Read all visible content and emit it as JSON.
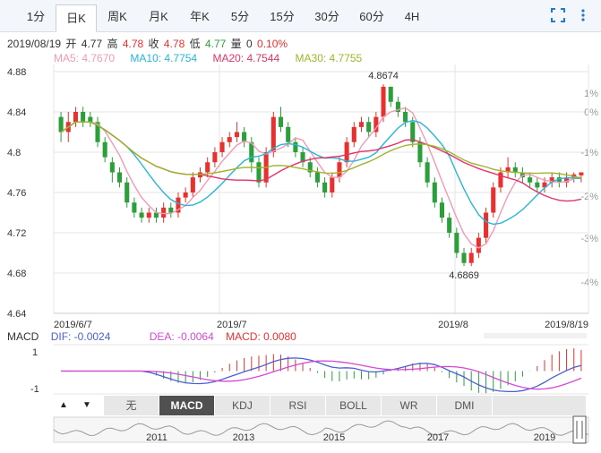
{
  "tabs": [
    {
      "label": "1分",
      "active": false
    },
    {
      "label": "日K",
      "active": true
    },
    {
      "label": "周K",
      "active": false
    },
    {
      "label": "月K",
      "active": false
    },
    {
      "label": "年K",
      "active": false
    },
    {
      "label": "5分",
      "active": false
    },
    {
      "label": "15分",
      "active": false
    },
    {
      "label": "30分",
      "active": false
    },
    {
      "label": "60分",
      "active": false
    },
    {
      "label": "4H",
      "active": false
    }
  ],
  "info": {
    "date": "2019/08/19",
    "open_label": "开",
    "open": "4.77",
    "high_label": "高",
    "high": "4.78",
    "close_label": "收",
    "close": "4.78",
    "low_label": "低",
    "low": "4.77",
    "vol_label": "量",
    "vol": "0",
    "change": "0.10%"
  },
  "ma": {
    "ma5": "MA5: 4.7670",
    "ma10": "MA10: 4.7754",
    "ma20": "MA20: 4.7544",
    "ma30": "MA30: 4.7755"
  },
  "colors": {
    "up": "#e8312f",
    "down": "#2a9f3a",
    "ma5": "#f29ab5",
    "ma10": "#27b6d6",
    "ma20": "#e2336b",
    "ma30": "#9fb52b",
    "dif": "#4a5fd0",
    "dea": "#d548d4",
    "grid": "#e6e6e6"
  },
  "chart_data": {
    "type": "candlestick",
    "y_ticks": [
      "4.88",
      "4.84",
      "4.8",
      "4.76",
      "4.72",
      "4.68",
      "4.64"
    ],
    "pct_ticks": [
      "1%",
      "0%",
      "-1%",
      "-2%",
      "-3%",
      "-4%"
    ],
    "ylim": [
      4.64,
      4.88
    ],
    "x_labels": [
      "2019/6/7",
      "2019/7",
      "2019/8",
      "2019/8/19"
    ],
    "max_label": "4.8674",
    "min_label": "4.6869",
    "candles": [
      [
        4.835,
        4.82,
        4.84,
        4.81
      ],
      [
        4.82,
        4.83,
        4.84,
        4.81
      ],
      [
        4.83,
        4.84,
        4.845,
        4.825
      ],
      [
        4.84,
        4.83,
        4.845,
        4.825
      ],
      [
        4.835,
        4.83,
        4.84,
        4.825
      ],
      [
        4.83,
        4.81,
        4.835,
        4.805
      ],
      [
        4.81,
        4.795,
        4.815,
        4.79
      ],
      [
        4.79,
        4.78,
        4.795,
        4.77
      ],
      [
        4.78,
        4.77,
        4.785,
        4.765
      ],
      [
        4.77,
        4.75,
        4.775,
        4.745
      ],
      [
        4.75,
        4.74,
        4.755,
        4.735
      ],
      [
        4.74,
        4.735,
        4.745,
        4.73
      ],
      [
        4.735,
        4.74,
        4.745,
        4.73
      ],
      [
        4.74,
        4.735,
        4.745,
        4.73
      ],
      [
        4.735,
        4.745,
        4.75,
        4.73
      ],
      [
        4.745,
        4.74,
        4.75,
        4.735
      ],
      [
        4.74,
        4.755,
        4.76,
        4.735
      ],
      [
        4.755,
        4.76,
        4.765,
        4.75
      ],
      [
        4.76,
        4.775,
        4.78,
        4.755
      ],
      [
        4.775,
        4.78,
        4.785,
        4.77
      ],
      [
        4.78,
        4.79,
        4.795,
        4.775
      ],
      [
        4.79,
        4.8,
        4.805,
        4.785
      ],
      [
        4.8,
        4.81,
        4.815,
        4.795
      ],
      [
        4.81,
        4.815,
        4.82,
        4.805
      ],
      [
        4.815,
        4.82,
        4.83,
        4.81
      ],
      [
        4.82,
        4.81,
        4.825,
        4.805
      ],
      [
        4.81,
        4.79,
        4.815,
        4.78
      ],
      [
        4.79,
        4.77,
        4.795,
        4.765
      ],
      [
        4.77,
        4.8,
        4.805,
        4.765
      ],
      [
        4.8,
        4.835,
        4.84,
        4.795
      ],
      [
        4.835,
        4.825,
        4.845,
        4.82
      ],
      [
        4.825,
        4.81,
        4.83,
        4.805
      ],
      [
        4.81,
        4.8,
        4.815,
        4.795
      ],
      [
        4.8,
        4.79,
        4.805,
        4.785
      ],
      [
        4.79,
        4.78,
        4.795,
        4.775
      ],
      [
        4.78,
        4.77,
        4.785,
        4.765
      ],
      [
        4.77,
        4.76,
        4.775,
        4.755
      ],
      [
        4.76,
        4.775,
        4.78,
        4.755
      ],
      [
        4.775,
        4.79,
        4.795,
        4.77
      ],
      [
        4.79,
        4.81,
        4.815,
        4.785
      ],
      [
        4.81,
        4.825,
        4.83,
        4.805
      ],
      [
        4.825,
        4.83,
        4.835,
        4.82
      ],
      [
        4.83,
        4.82,
        4.835,
        4.815
      ],
      [
        4.82,
        4.835,
        4.84,
        4.815
      ],
      [
        4.835,
        4.865,
        4.8674,
        4.83
      ],
      [
        4.865,
        4.85,
        4.865,
        4.845
      ],
      [
        4.85,
        4.84,
        4.855,
        4.835
      ],
      [
        4.84,
        4.83,
        4.845,
        4.825
      ],
      [
        4.83,
        4.81,
        4.835,
        4.805
      ],
      [
        4.81,
        4.79,
        4.815,
        4.785
      ],
      [
        4.79,
        4.77,
        4.795,
        4.765
      ],
      [
        4.77,
        4.75,
        4.775,
        4.745
      ],
      [
        4.75,
        4.735,
        4.755,
        4.73
      ],
      [
        4.735,
        4.72,
        4.74,
        4.715
      ],
      [
        4.72,
        4.7,
        4.725,
        4.695
      ],
      [
        4.7,
        4.69,
        4.705,
        4.6869
      ],
      [
        4.69,
        4.7,
        4.705,
        4.6869
      ],
      [
        4.7,
        4.715,
        4.72,
        4.695
      ],
      [
        4.715,
        4.74,
        4.745,
        4.71
      ],
      [
        4.74,
        4.765,
        4.77,
        4.735
      ],
      [
        4.765,
        4.78,
        4.785,
        4.76
      ],
      [
        4.78,
        4.785,
        4.795,
        4.775
      ],
      [
        4.785,
        4.78,
        4.79,
        4.775
      ],
      [
        4.78,
        4.775,
        4.785,
        4.77
      ],
      [
        4.775,
        4.77,
        4.78,
        4.765
      ],
      [
        4.77,
        4.765,
        4.775,
        4.76
      ],
      [
        4.765,
        4.77,
        4.775,
        4.76
      ],
      [
        4.77,
        4.775,
        4.78,
        4.765
      ],
      [
        4.775,
        4.77,
        4.78,
        4.765
      ],
      [
        4.77,
        4.775,
        4.78,
        4.765
      ],
      [
        4.775,
        4.778,
        4.78,
        4.77
      ],
      [
        4.777,
        4.78,
        4.78,
        4.77
      ]
    ]
  },
  "macd": {
    "label": "MACD",
    "dif": "DIF: -0.0024",
    "dea": "DEA: -0.0064",
    "macd": "MACD: 0.0080",
    "y_ticks": [
      "1",
      "-1"
    ]
  },
  "nav": {
    "prev": "▲",
    "next": "▼"
  },
  "indicator_tabs": [
    {
      "label": "无",
      "active": false
    },
    {
      "label": "MACD",
      "active": true
    },
    {
      "label": "KDJ",
      "active": false
    },
    {
      "label": "RSI",
      "active": false
    },
    {
      "label": "BOLL",
      "active": false
    },
    {
      "label": "WR",
      "active": false
    },
    {
      "label": "DMI",
      "active": false
    }
  ],
  "overview": {
    "year_labels": [
      "2011",
      "2013",
      "2015",
      "2017",
      "2019"
    ]
  }
}
